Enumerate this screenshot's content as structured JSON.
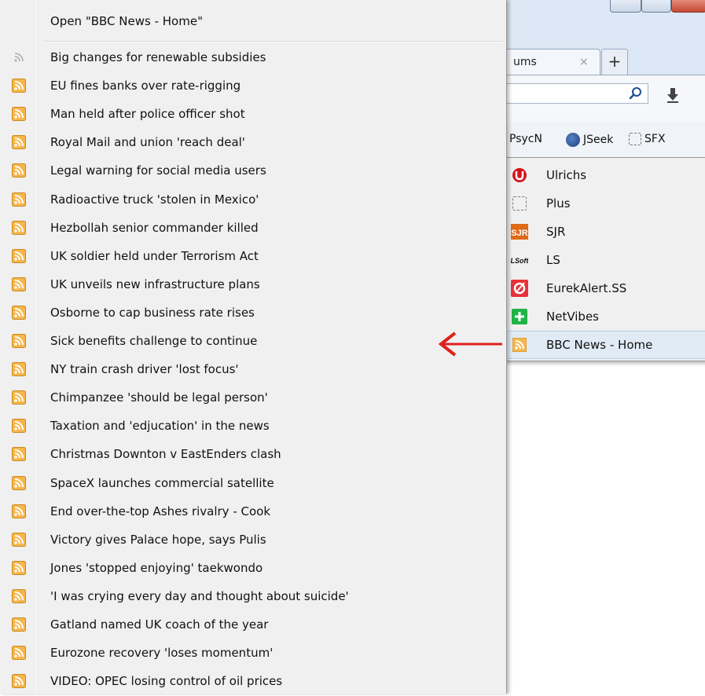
{
  "browser": {
    "tab": {
      "label": "ums",
      "close": "×"
    },
    "new_tab": "+",
    "bookmarks": [
      {
        "label": "PsycN"
      },
      {
        "label": "JSeek"
      },
      {
        "label": "SFX"
      }
    ]
  },
  "menu": {
    "open_label": "Open \"BBC News - Home\"",
    "feed_items": [
      "Big changes for renewable subsidies",
      "EU fines banks over rate-rigging",
      "Man held after police officer shot",
      "Royal Mail and union 'reach deal'",
      "Legal warning for social media users",
      "Radioactive truck 'stolen in Mexico'",
      "Hezbollah senior commander killed",
      "UK soldier held under Terrorism Act",
      "UK unveils new infrastructure plans",
      "Osborne to cap business rate rises",
      "Sick benefits challenge to continue",
      "NY train crash driver 'lost focus'",
      "Chimpanzee 'should be legal person'",
      "Taxation and 'edjucation' in the news",
      "Christmas Downton v EastEnders clash",
      "SpaceX launches commercial satellite",
      "End over-the-top Ashes rivalry - Cook",
      "Victory gives Palace hope, says Pulis",
      "Jones 'stopped enjoying' taekwondo",
      "'I was crying every day and thought about suicide'",
      "Gatland named UK coach of the year",
      "Eurozone recovery 'loses momentum'",
      "VIDEO: OPEC losing control of oil prices"
    ]
  },
  "submenu": {
    "items": [
      {
        "label": "Ulrichs",
        "icon": "ulrichs-icon"
      },
      {
        "label": "Plus",
        "icon": "dashed-box-icon"
      },
      {
        "label": "SJR",
        "icon": "sjr-icon"
      },
      {
        "label": "LS",
        "icon": "lsoft-icon"
      },
      {
        "label": "EurekAlert.SS",
        "icon": "eurekalert-icon"
      },
      {
        "label": "NetVibes",
        "icon": "netvibes-icon"
      },
      {
        "label": "BBC News - Home",
        "icon": "rss-icon",
        "highlighted": true
      }
    ]
  },
  "colors": {
    "rss_orange": "#f5a42a",
    "arrow_red": "#e0201c",
    "highlight": "#e1ebf6"
  },
  "icons": {
    "sjr_text": "SJR",
    "lsoft_text": "LSoft"
  }
}
